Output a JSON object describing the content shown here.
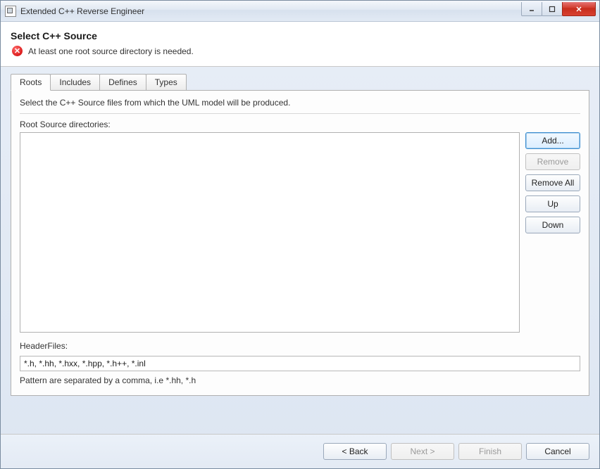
{
  "window": {
    "title": "Extended C++ Reverse Engineer"
  },
  "header": {
    "title": "Select C++ Source",
    "message": "At least one root source directory is needed."
  },
  "tabs": [
    {
      "label": "Roots",
      "active": true
    },
    {
      "label": "Includes",
      "active": false
    },
    {
      "label": "Defines",
      "active": false
    },
    {
      "label": "Types",
      "active": false
    }
  ],
  "panel": {
    "description": "Select the C++ Source files from which the UML model will be produced.",
    "root_label": "Root Source directories:",
    "headerfiles_label": "HeaderFiles:",
    "headerfiles_value": "*.h, *.hh, *.hxx, *.hpp, *.h++, *.inl",
    "pattern_hint": "Pattern are separated by a comma, i.e *.hh, *.h"
  },
  "side_buttons": {
    "add": "Add...",
    "remove": "Remove",
    "remove_all": "Remove All",
    "up": "Up",
    "down": "Down"
  },
  "footer": {
    "back": "< Back",
    "next": "Next >",
    "finish": "Finish",
    "cancel": "Cancel"
  }
}
